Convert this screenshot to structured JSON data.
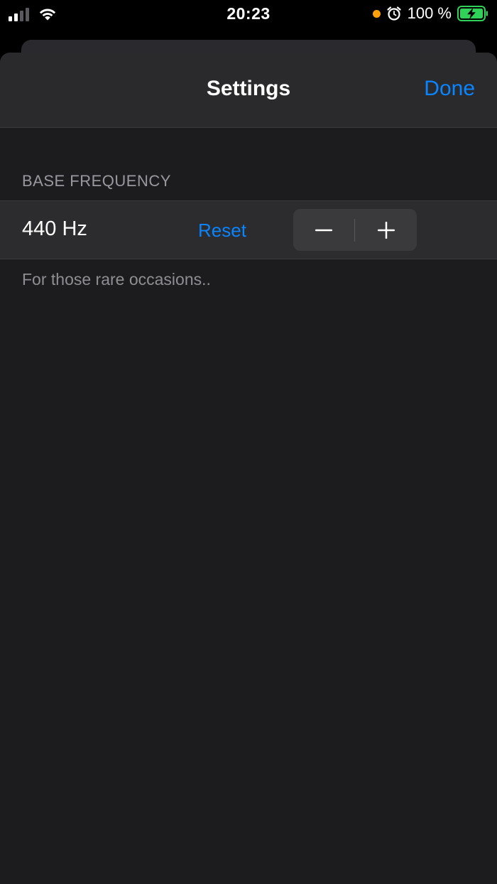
{
  "status_bar": {
    "time": "20:23",
    "battery_percent": "100 %",
    "signal_bars_active": 2,
    "signal_bars_total": 4,
    "icons": [
      "signal-icon",
      "wifi-icon",
      "orange-dot-indicator",
      "alarm-icon",
      "battery-charging-icon"
    ],
    "colors": {
      "orange_dot": "#ff9f0a",
      "battery_fill": "#30d158"
    }
  },
  "nav": {
    "title": "Settings",
    "done_label": "Done"
  },
  "section": {
    "header": "BASE FREQUENCY",
    "frequency_value": "440 Hz",
    "reset_label": "Reset",
    "stepper": {
      "minus_icon": "minus-icon",
      "plus_icon": "plus-icon"
    },
    "footer": "For those rare occasions.."
  },
  "colors": {
    "accent": "#0a84ff",
    "background": "#1c1c1e",
    "row_background": "#2c2c2e"
  }
}
